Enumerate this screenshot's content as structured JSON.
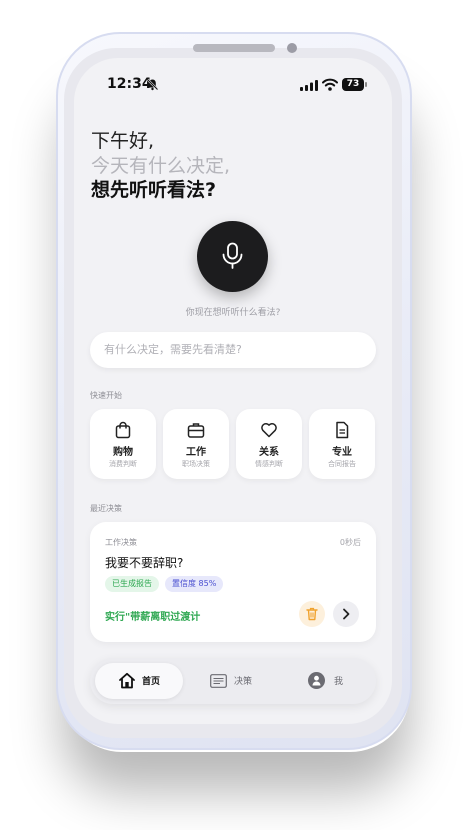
{
  "status": {
    "time": "12:34",
    "battery": "73"
  },
  "greeting": {
    "line1": "下午好,",
    "line2": "今天有什么决定,",
    "line3": "想先听听看法?"
  },
  "mic": {
    "hint": "你现在想听听什么看法?"
  },
  "search": {
    "placeholder": "有什么决定，需要先看清楚?"
  },
  "quick_start": {
    "label": "快速开始",
    "items": [
      {
        "title": "购物",
        "subtitle": "消费判断",
        "icon": "shopping-bag-icon"
      },
      {
        "title": "工作",
        "subtitle": "职场决策",
        "icon": "briefcase-icon"
      },
      {
        "title": "关系",
        "subtitle": "情感判断",
        "icon": "heart-icon"
      },
      {
        "title": "专业",
        "subtitle": "合同报告",
        "icon": "document-icon"
      }
    ]
  },
  "recent": {
    "label": "最近决策",
    "card": {
      "category": "工作决策",
      "time": "0秒后",
      "title": "我要不要辞职?",
      "tag_report": "已生成报告",
      "tag_confidence": "置信度 85%",
      "action": "实行\"带薪离职过渡计",
      "colors": {
        "green": "#2fa852",
        "indigo": "#4a4fd0"
      }
    }
  },
  "tabbar": {
    "home": "首页",
    "decisions": "决策",
    "me": "我"
  }
}
